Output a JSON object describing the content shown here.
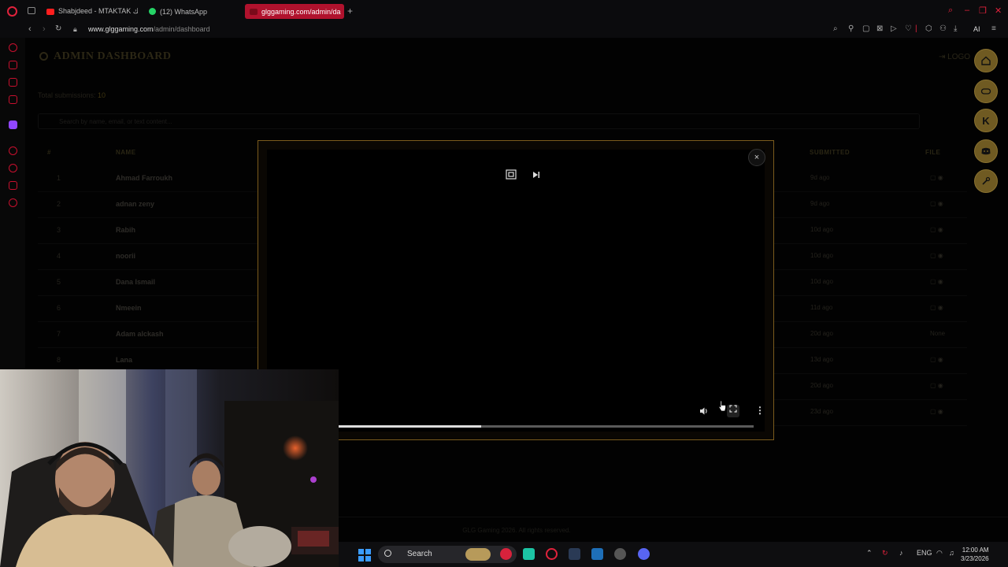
{
  "browser": {
    "tabs": [
      {
        "label": "Shabjdeed - MTAKTAK ملك",
        "favicon_color": "#ff1e1e"
      },
      {
        "label": "(12) WhatsApp",
        "favicon_color": "#25d366"
      },
      {
        "label": "glggaming.com/admin/da",
        "favicon_color": "#c8102e"
      }
    ],
    "address": {
      "domain": "www.glggaming.com",
      "path": "/admin/dashboard"
    },
    "ai_label": "AI"
  },
  "page": {
    "title": "ADMIN DASHBOARD",
    "logout_label": "LOGO",
    "total_label": "Total submissions:",
    "total_value": "10",
    "search_placeholder": "Search by name, email, or text content...",
    "columns": {
      "num": "#",
      "name": "NAME",
      "submitted": "SUBMITTED",
      "file": "FILE"
    },
    "rows": [
      {
        "num": "1",
        "name": "Ahmad Farroukh",
        "submitted": "9d ago"
      },
      {
        "num": "2",
        "name": "adnan zeny",
        "submitted": "9d ago"
      },
      {
        "num": "3",
        "name": "Rabih",
        "submitted": "10d ago"
      },
      {
        "num": "4",
        "name": "noorii",
        "submitted": "10d ago"
      },
      {
        "num": "5",
        "name": "Dana Ismail",
        "submitted": "10d ago"
      },
      {
        "num": "6",
        "name": "Nmeein",
        "submitted": "11d ago"
      },
      {
        "num": "7",
        "name": "Adam alckash",
        "submitted": "20d ago",
        "file": "None"
      },
      {
        "num": "8",
        "name": "Lana",
        "submitted": "13d ago"
      },
      {
        "num": "9",
        "name": "",
        "submitted": "20d ago"
      },
      {
        "num": "10",
        "name": "",
        "submitted": "23d ago"
      }
    ],
    "footer": "GLG Gaming 2026. All rights reserved."
  },
  "fab_menu": {
    "k_label": "K"
  },
  "video_modal": {
    "close_label": "×",
    "progress": 0.44
  },
  "taskbar": {
    "search_label": "Search",
    "lang": "ENG",
    "time": "12:00 AM",
    "date": "3/23/2026"
  },
  "colors": {
    "accent": "#c8102e",
    "gold": "#7a5b1d"
  }
}
